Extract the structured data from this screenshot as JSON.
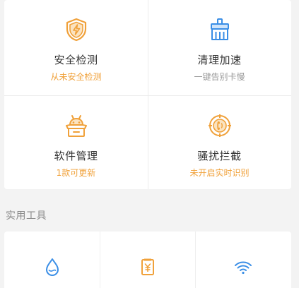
{
  "colors": {
    "orange": "#f0a13a",
    "blue": "#3a8ee6",
    "gray_text": "#9a9a9a"
  },
  "features": [
    {
      "title": "安全检测",
      "subtitle": "从未安全检测",
      "subtitle_color": "orange",
      "icon": "shield-lightning-icon"
    },
    {
      "title": "清理加速",
      "subtitle": "一键告别卡慢",
      "subtitle_color": "gray",
      "icon": "broom-icon"
    },
    {
      "title": "软件管理",
      "subtitle": "1款可更新",
      "subtitle_color": "orange",
      "icon": "android-box-icon"
    },
    {
      "title": "骚扰拦截",
      "subtitle": "未开启实时识别",
      "subtitle_color": "orange",
      "icon": "phone-target-icon"
    }
  ],
  "tools_section": {
    "title": "实用工具",
    "items": [
      {
        "icon": "water-drop-icon"
      },
      {
        "icon": "yuan-receipt-icon"
      },
      {
        "icon": "wifi-icon"
      }
    ]
  }
}
